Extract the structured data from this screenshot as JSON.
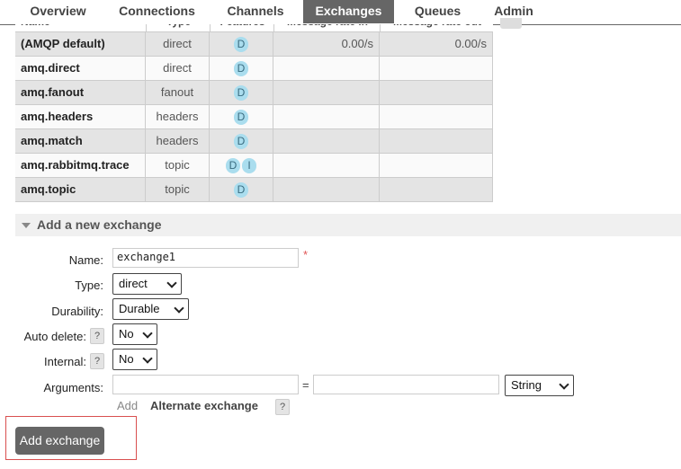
{
  "nav": {
    "tabs": [
      {
        "label": "Overview"
      },
      {
        "label": "Connections"
      },
      {
        "label": "Channels"
      },
      {
        "label": "Exchanges"
      },
      {
        "label": "Queues"
      },
      {
        "label": "Admin"
      }
    ],
    "active_tab": "Exchanges"
  },
  "table": {
    "headers": [
      "Name",
      "Type",
      "Features",
      "Message rate in",
      "Message rate out"
    ],
    "rows": [
      {
        "name": "(AMQP default)",
        "type": "direct",
        "features": [
          "D"
        ],
        "rate_in": "0.00/s",
        "rate_out": "0.00/s"
      },
      {
        "name": "amq.direct",
        "type": "direct",
        "features": [
          "D"
        ],
        "rate_in": "",
        "rate_out": ""
      },
      {
        "name": "amq.fanout",
        "type": "fanout",
        "features": [
          "D"
        ],
        "rate_in": "",
        "rate_out": ""
      },
      {
        "name": "amq.headers",
        "type": "headers",
        "features": [
          "D"
        ],
        "rate_in": "",
        "rate_out": ""
      },
      {
        "name": "amq.match",
        "type": "headers",
        "features": [
          "D"
        ],
        "rate_in": "",
        "rate_out": ""
      },
      {
        "name": "amq.rabbitmq.trace",
        "type": "topic",
        "features": [
          "D",
          "I"
        ],
        "rate_in": "",
        "rate_out": ""
      },
      {
        "name": "amq.topic",
        "type": "topic",
        "features": [
          "D"
        ],
        "rate_in": "",
        "rate_out": ""
      }
    ]
  },
  "add_section": {
    "title": "Add a new exchange",
    "name_label": "Name:",
    "name_value": "exchange1",
    "required_mark": "*",
    "type_label": "Type:",
    "type_value": "direct",
    "durability_label": "Durability:",
    "durability_value": "Durable",
    "auto_delete_label": "Auto delete:",
    "auto_delete_value": "No",
    "internal_label": "Internal:",
    "internal_value": "No",
    "help_mark": "?",
    "arguments_label": "Arguments:",
    "arguments_key": "",
    "arguments_equals": "=",
    "arguments_value": "",
    "arguments_type": "String",
    "add_link": "Add",
    "alternate_exchange": "Alternate exchange",
    "submit_label": "Add exchange"
  },
  "colors": {
    "nav_active_bg": "#666666",
    "row_odd_bg": "#e4e4e4",
    "badge_bg": "#aaddee",
    "required_color": "#e05555",
    "focus_outline": "#d94f4f"
  }
}
